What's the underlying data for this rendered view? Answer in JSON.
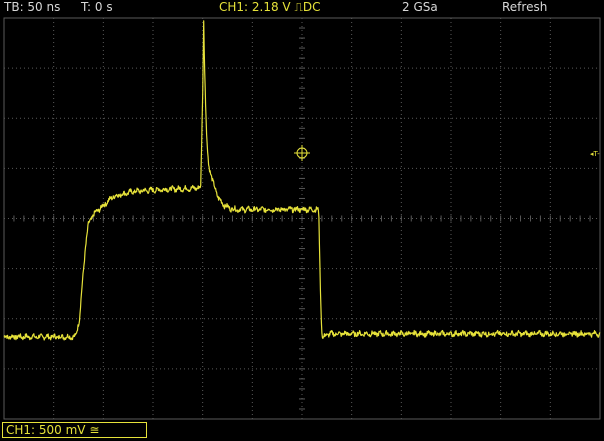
{
  "header": {
    "timebase": "TB: 50 ns",
    "trigger_offset": "T: 0 s",
    "channel_info": "CH1: 2.18 V ⎍DC",
    "sample_rate": "2 GSa",
    "mode": "Refresh"
  },
  "footer": {
    "channel_scale": "CH1: 500 mV ≅"
  },
  "markers": {
    "trigger_level": "◂T-"
  },
  "colors": {
    "trace": "#e6e23a",
    "grid": "#5a5a5a",
    "background": "#000000",
    "text": "#d8d8d8"
  },
  "chart_data": {
    "type": "line",
    "x_unit": "ns",
    "y_unit": "V",
    "x_per_div": 50,
    "y_per_div": 0.5,
    "xlim": [
      -300,
      300
    ],
    "trigger_level_V": 2.18,
    "series": [
      {
        "name": "CH1",
        "points": [
          [
            -300,
            1.0
          ],
          [
            -236,
            1.0
          ],
          [
            -228,
            1.0
          ],
          [
            -224,
            1.18
          ],
          [
            -221,
            1.55
          ],
          [
            -218,
            1.9
          ],
          [
            -215,
            2.12
          ],
          [
            -210,
            2.22
          ],
          [
            -200,
            2.31
          ],
          [
            -190,
            2.4
          ],
          [
            -170,
            2.45
          ],
          [
            -140,
            2.47
          ],
          [
            -110,
            2.48
          ],
          [
            -102,
            2.49
          ],
          [
            -101,
            2.95
          ],
          [
            -100,
            3.45
          ],
          [
            -99,
            4.15
          ],
          [
            -98,
            3.65
          ],
          [
            -96,
            3.0
          ],
          [
            -94,
            2.72
          ],
          [
            -90,
            2.55
          ],
          [
            -84,
            2.38
          ],
          [
            -78,
            2.31
          ],
          [
            -72,
            2.28
          ],
          [
            -66,
            2.27
          ],
          [
            -40,
            2.27
          ],
          [
            0,
            2.27
          ],
          [
            16,
            2.27
          ],
          [
            17,
            2.2
          ],
          [
            18,
            1.7
          ],
          [
            19,
            1.3
          ],
          [
            20,
            1.05
          ],
          [
            21,
            0.98
          ],
          [
            24,
            1.02
          ],
          [
            30,
            1.03
          ],
          [
            300,
            1.03
          ]
        ]
      }
    ]
  }
}
